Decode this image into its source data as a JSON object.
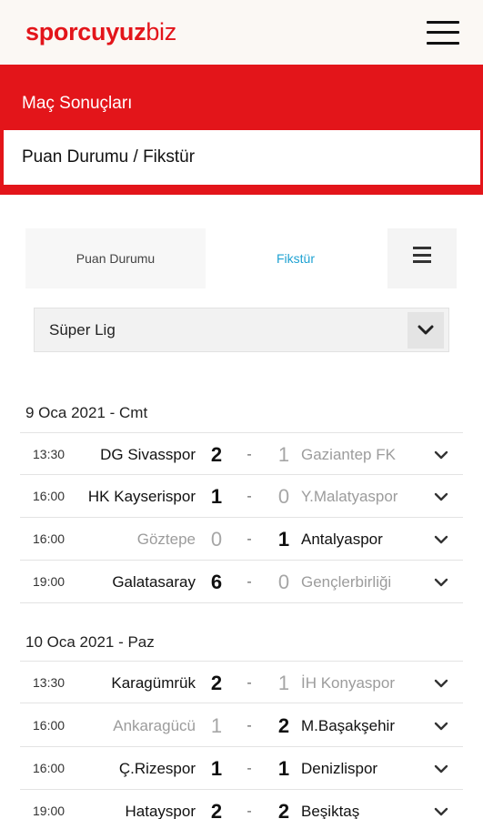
{
  "logo": {
    "bold": "sporcuyuz",
    "light": "biz"
  },
  "header": {
    "title": "Maç Sonuçları",
    "subtitle": "Puan Durumu / Fikstür"
  },
  "tabs": {
    "standings": "Puan Durumu",
    "fixture": "Fikstür"
  },
  "league_select": {
    "value": "Süper Lig"
  },
  "days": [
    {
      "label": "9 Oca 2021 - Cmt",
      "matches": [
        {
          "time": "13:30",
          "home": "DG Sivasspor",
          "home_score": "2",
          "away_score": "1",
          "away": "Gaziantep FK",
          "winner": "home"
        },
        {
          "time": "16:00",
          "home": "HK Kayserispor",
          "home_score": "1",
          "away_score": "0",
          "away": "Y.Malatyaspor",
          "winner": "home"
        },
        {
          "time": "16:00",
          "home": "Göztepe",
          "home_score": "0",
          "away_score": "1",
          "away": "Antalyaspor",
          "winner": "away"
        },
        {
          "time": "19:00",
          "home": "Galatasaray",
          "home_score": "6",
          "away_score": "0",
          "away": "Gençlerbirliği",
          "winner": "home"
        }
      ]
    },
    {
      "label": "10 Oca 2021 - Paz",
      "matches": [
        {
          "time": "13:30",
          "home": "Karagümrük",
          "home_score": "2",
          "away_score": "1",
          "away": "İH Konyaspor",
          "winner": "home"
        },
        {
          "time": "16:00",
          "home": "Ankaragücü",
          "home_score": "1",
          "away_score": "2",
          "away": "M.Başakşehir",
          "winner": "away"
        },
        {
          "time": "16:00",
          "home": "Ç.Rizespor",
          "home_score": "1",
          "away_score": "1",
          "away": "Denizlispor",
          "winner": "draw"
        },
        {
          "time": "19:00",
          "home": "Hatayspor",
          "home_score": "2",
          "away_score": "2",
          "away": "Beşiktaş",
          "winner": "draw"
        }
      ]
    }
  ]
}
